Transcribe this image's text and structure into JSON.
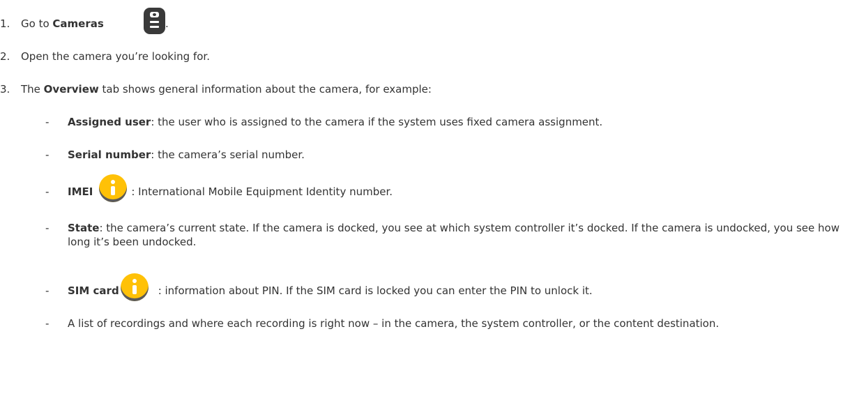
{
  "steps": [
    {
      "num": "1.",
      "pre": "Go to ",
      "bold": "Cameras",
      "post": " ."
    },
    {
      "num": "2.",
      "text": "Open the camera you’re looking for."
    },
    {
      "num": "3.",
      "pre": "The ",
      "bold": "Overview",
      "post": " tab shows general information about the camera, for example:"
    }
  ],
  "dash": "-",
  "bullets": {
    "assigned_user": {
      "bold": "Assigned user",
      "text": ": the user who is assigned to the camera if the system uses fixed camera assignment."
    },
    "serial_number": {
      "bold": "Serial number",
      "text": ": the camera’s serial number."
    },
    "imei": {
      "bold": "IMEI",
      "text": ": International Mobile Equipment Identity number."
    },
    "state": {
      "bold": "State",
      "text": ": the camera’s current state. If the camera is docked, you see at which system controller it’s docked. If the camera is undocked, you see how long it’s been undocked."
    },
    "sim_card": {
      "bold": "SIM card",
      "text": ": information about PIN. If the SIM card is locked you can enter the PIN to unlock it."
    },
    "recordings": {
      "text": "A list of recordings and where each recording is right now – in the camera, the system controller, or the content destination."
    }
  },
  "icons": {
    "cameras": "camera-icon",
    "note": "info-icon",
    "note_color": "#ffc107"
  }
}
